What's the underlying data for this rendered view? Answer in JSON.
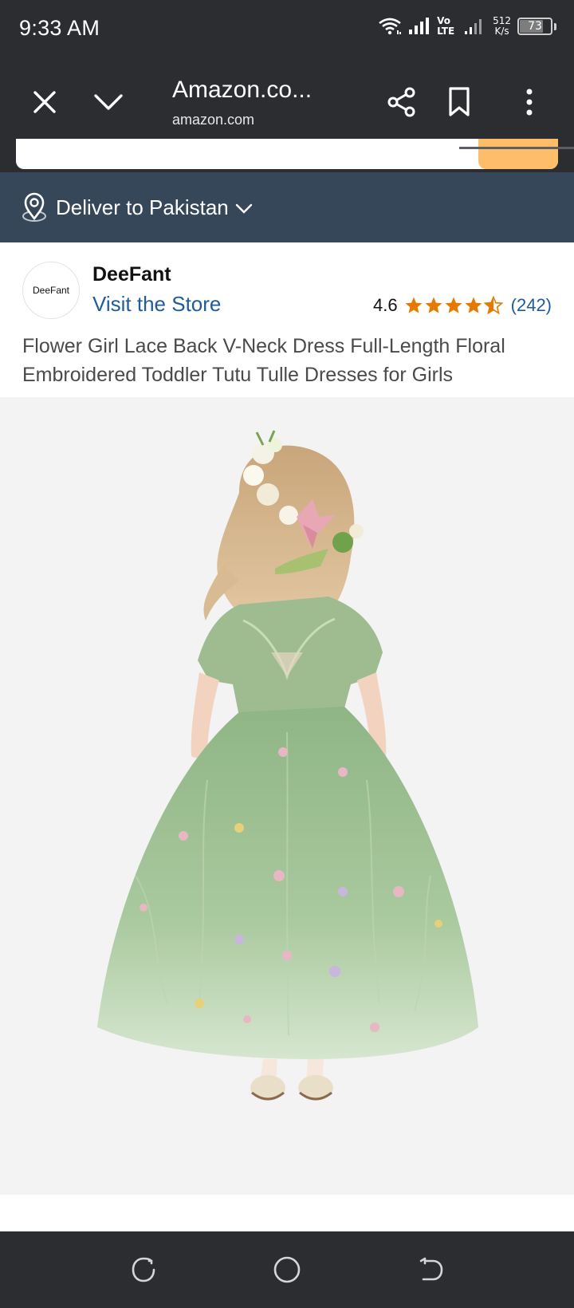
{
  "status_bar": {
    "time": "9:33 AM",
    "volte": "Vo LTE",
    "net_speed_value": "512",
    "net_speed_unit": "K/s",
    "battery_level": "73"
  },
  "browser": {
    "title": "Amazon.co...",
    "url": "amazon.com",
    "icons": [
      "close-icon",
      "chevron-down-icon",
      "share-icon",
      "bookmark-icon",
      "more-vert-icon"
    ]
  },
  "deliver": {
    "text": "Deliver to Pakistan",
    "icon": "location-pin-icon"
  },
  "store": {
    "logo_text": "DeeFant",
    "brand_name": "DeeFant",
    "visit_label": "Visit the Store",
    "rating": "4.6",
    "rating_stars": 4.5,
    "review_count": "(242)"
  },
  "product": {
    "title": "Flower Girl Lace Back V-Neck Dress Full-Length Floral Embroidered Toddler Tutu Tulle Dresses for Girls"
  },
  "colors": {
    "status_bg": "#2b2d31",
    "deliver_bg": "#37475a",
    "link": "#1f5c99",
    "star": "#e67a00",
    "search_button": "#febd69",
    "dress_green": "#a6c79a"
  },
  "nav_bar": {
    "icons": [
      "recent-apps-icon",
      "home-icon",
      "back-icon"
    ]
  }
}
